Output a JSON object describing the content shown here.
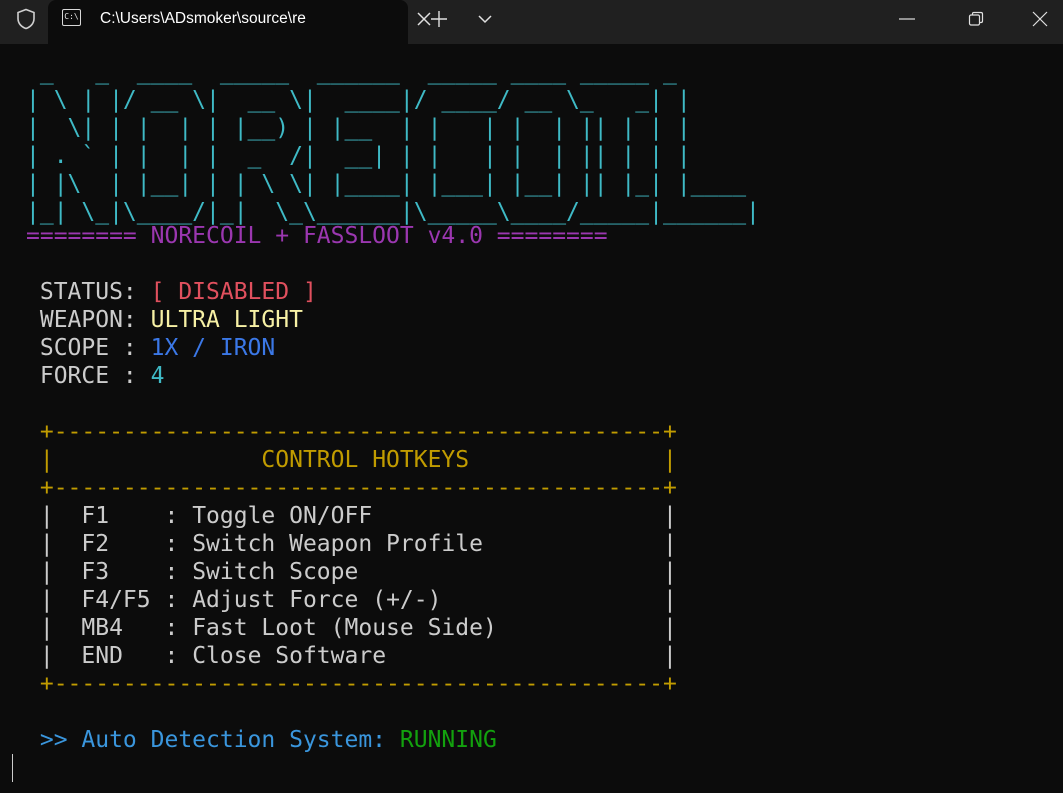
{
  "window": {
    "tab_title": "C:\\Users\\ADsmoker\\source\\re",
    "tab_icon_text": "C:\\"
  },
  "icons": {
    "shield": "shield-icon",
    "terminal": "terminal-icon",
    "close_tab": "close-icon",
    "new_tab": "plus-icon",
    "dropdown": "chevron-down-icon",
    "minimize": "minimize-icon",
    "maximize": "restore-icon",
    "close_window": "close-icon"
  },
  "banner": {
    "lines": [
      " _   _  ____  _____  ______  _____ ____ _____ _",
      "| \\ | |/ __ \\|  __ \\|  ____|/ ____/ __ \\_   _| |",
      "|  \\| | |  | | |__) | |__  | |   | |  | || | | |",
      "| . ` | |  | |  _  /|  __| | |   | |  | || | | |",
      "| |\\  | |__| | | \\ \\| |____| |___| |__| || |_| |____",
      "|_| \\_|\\____/|_|  \\_\\______|\\_____\\____/_____|______|"
    ],
    "subtitle": "======== NORECOIL + FASSLOOT v4.0 ========"
  },
  "status": {
    "status_label": " STATUS: ",
    "status_value": "[ DISABLED ]",
    "weapon_label": " WEAPON: ",
    "weapon_value": "ULTRA LIGHT",
    "scope_label": " SCOPE : ",
    "scope_value": "1X / IRON",
    "force_label": " FORCE : ",
    "force_value": "4"
  },
  "hotkeys": {
    "border": " +--------------------------------------------+",
    "header_left": " |",
    "header_pad_left": "               ",
    "header": "CONTROL HOTKEYS",
    "header_pad_right": "              ",
    "header_right": "|",
    "rows": [
      {
        "left": " |  ",
        "key": "F1",
        "key_pad": "    ",
        "sep": ": ",
        "action": "Toggle ON/OFF",
        "pad": "                     ",
        "right": "|"
      },
      {
        "left": " |  ",
        "key": "F2",
        "key_pad": "    ",
        "sep": ": ",
        "action": "Switch Weapon Profile",
        "pad": "             ",
        "right": "|"
      },
      {
        "left": " |  ",
        "key": "F3",
        "key_pad": "    ",
        "sep": ": ",
        "action": "Switch Scope",
        "pad": "                      ",
        "right": "|"
      },
      {
        "left": " |  ",
        "key": "F4/F5",
        "key_pad": " ",
        "sep": ": ",
        "action": "Adjust Force (+/-)",
        "pad": "                ",
        "right": "|"
      },
      {
        "left": " |  ",
        "key": "MB4",
        "key_pad": "   ",
        "sep": ": ",
        "action": "Fast Loot (Mouse Side)",
        "pad": "            ",
        "right": "|"
      },
      {
        "left": " |  ",
        "key": "END",
        "key_pad": "   ",
        "sep": ": ",
        "action": "Close Software",
        "pad": "                    ",
        "right": "|"
      }
    ]
  },
  "footer": {
    "prefix": " >> Auto Detection System: ",
    "value": "RUNNING"
  }
}
